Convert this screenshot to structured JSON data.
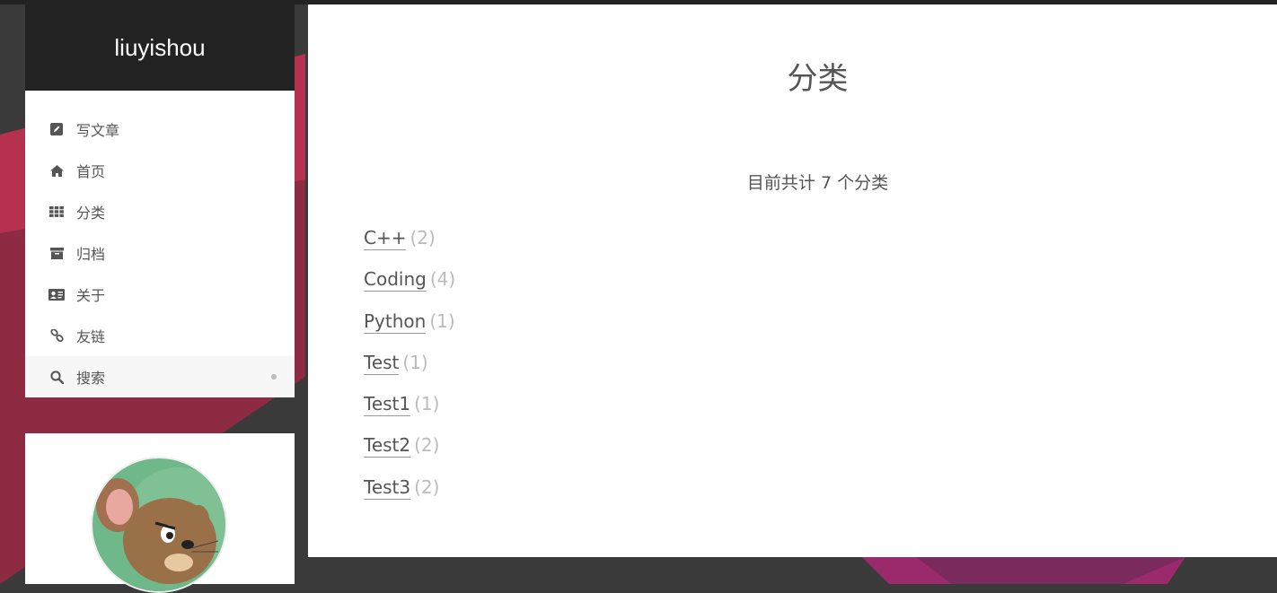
{
  "site": {
    "brand": "liuyishou"
  },
  "menu": {
    "items": [
      {
        "label": "写文章",
        "icon": "edit-icon"
      },
      {
        "label": "首页",
        "icon": "home-icon"
      },
      {
        "label": "分类",
        "icon": "th-icon"
      },
      {
        "label": "归档",
        "icon": "archive-icon"
      },
      {
        "label": "关于",
        "icon": "id-card-icon"
      },
      {
        "label": "友链",
        "icon": "link-icon"
      },
      {
        "label": "搜索",
        "icon": "search-icon",
        "active": true
      }
    ]
  },
  "author": {
    "avatar": "avatar-image"
  },
  "main": {
    "title": "分类",
    "summary": "目前共计 7 个分类",
    "categories": [
      {
        "name": "C++",
        "count": "(2)"
      },
      {
        "name": "Coding",
        "count": "(4)"
      },
      {
        "name": "Python",
        "count": "(1)"
      },
      {
        "name": "Test",
        "count": "(1)"
      },
      {
        "name": "Test1",
        "count": "(1)"
      },
      {
        "name": "Test2",
        "count": "(2)"
      },
      {
        "name": "Test3",
        "count": "(2)"
      }
    ]
  },
  "colors": {
    "background": "#3a3a3a",
    "brand_bar": "#222222",
    "text": "#555555",
    "count": "#bbbbbb",
    "accent_red": "#b5314f",
    "accent_magenta": "#9a2a6b"
  }
}
